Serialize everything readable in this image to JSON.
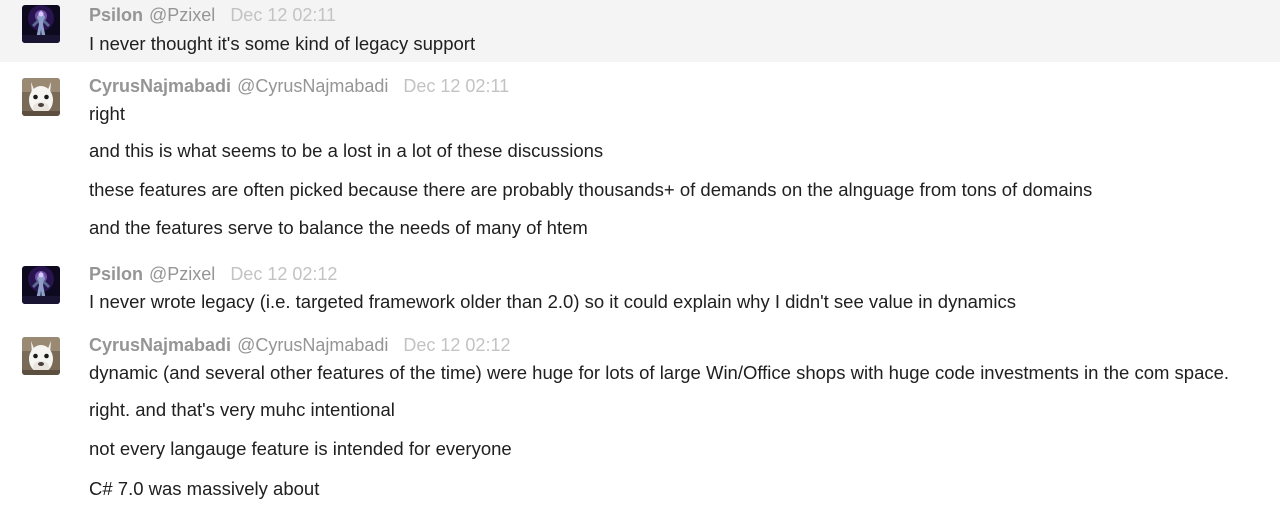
{
  "messages": [
    {
      "author": "Psilon",
      "handle": "@Pzixel",
      "time": "Dec 12 02:11",
      "avatar_icon": "dark-figure-avatar-icon",
      "lines": [
        "I never thought it's some kind of legacy support"
      ]
    },
    {
      "author": "CyrusNajmabadi",
      "handle": "@CyrusNajmabadi",
      "time": "Dec 12 02:11",
      "avatar_icon": "white-llama-avatar-icon",
      "lines": [
        "right",
        "and this is what seems to be a lost in a lot of these discussions",
        "these features are often picked because there are probably thousands+ of demands on the alnguage from tons of domains",
        "and the features serve to balance the needs of many of htem"
      ]
    },
    {
      "author": "Psilon",
      "handle": "@Pzixel",
      "time": "Dec 12 02:12",
      "avatar_icon": "dark-figure-avatar-icon",
      "lines": [
        "I never wrote legacy (i.e. targeted framework older than 2.0) so it could explain why I didn't see value in dynamics"
      ]
    },
    {
      "author": "CyrusNajmabadi",
      "handle": "@CyrusNajmabadi",
      "time": "Dec 12 02:12",
      "avatar_icon": "white-llama-avatar-icon",
      "lines": [
        "dynamic (and several other features of the time) were huge for lots of large Win/Office shops with huge code investments in the com space.",
        "right. and that's very muhc intentional",
        "not every langauge feature is intended for everyone",
        "C# 7.0 was massively about"
      ]
    }
  ],
  "colors": {
    "highlight_bg": "#f4f4f4",
    "author": "#959595",
    "timestamp": "#c3c3c3",
    "text": "#202020"
  }
}
